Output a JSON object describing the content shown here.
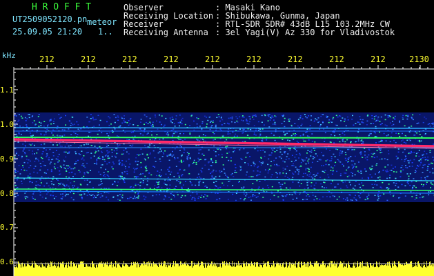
{
  "header": {
    "logo": "H R O F F T",
    "filename": "UT2509052120.pn",
    "file_type": "meteor",
    "datetime": "25.09.05 21:20",
    "counter": "1..",
    "fields": [
      {
        "label": "Observer",
        "value": ": Masaki Kano"
      },
      {
        "label": "Receiving Location",
        "value": ": Shibukawa, Gunma, Japan"
      },
      {
        "label": "Receiver",
        "value": ": RTL-SDR SDR# 43dB L15 103.2MHz CW"
      },
      {
        "label": "Receiving Antenna",
        "value": ": 3el Yagi(V) Az 330 for Vladivostok"
      }
    ]
  },
  "axis": {
    "unit": "kHz",
    "y_ticks": [
      "1.1",
      "1.0",
      "0.9",
      "0.8",
      "0.7",
      "0.6"
    ],
    "x_ticks": [
      "212",
      "212",
      "212",
      "212",
      "212",
      "212",
      "212",
      "212",
      "212",
      "2130"
    ]
  },
  "colors": {
    "header_green": "#3cff3c",
    "header_cyan": "#7fe6ff",
    "axis_yellow": "#ffff30",
    "echo_red": "#ff2a6a",
    "noise_blue": "#1a3cff"
  }
}
